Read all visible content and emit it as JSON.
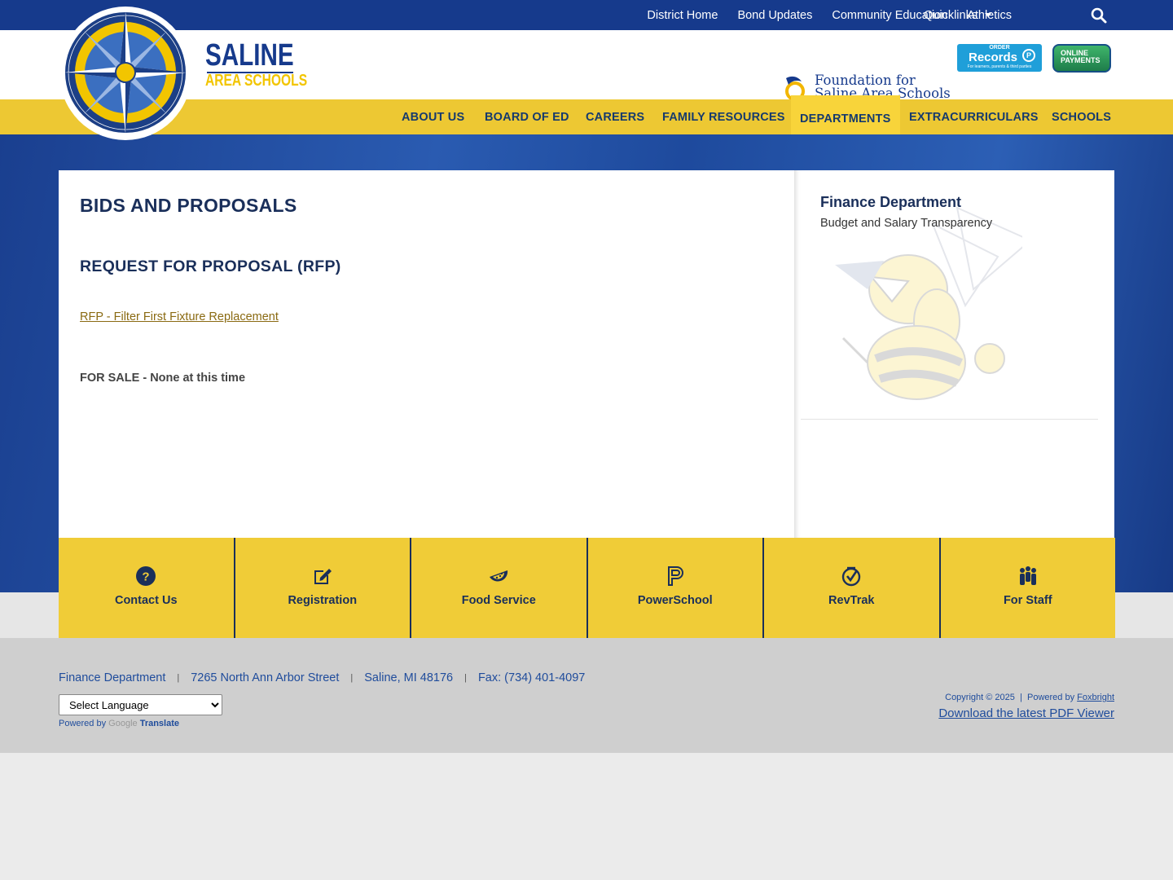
{
  "utility": {
    "links": [
      "District Home",
      "Bond Updates",
      "Community Education",
      "Athletics"
    ],
    "quicklinks": "Quicklinks",
    "search_icon": "search-icon"
  },
  "logo": {
    "line1": "SALINE",
    "line2": "AREA SCHOOLS"
  },
  "partners": {
    "foundation_line1": "Foundation for",
    "foundation_line2": "Saline Area Schools",
    "records_top": "ORDER",
    "records_main": "Records",
    "records_sub": "For learners, parents & third parties",
    "payments_line1": "ONLINE",
    "payments_line2": "PAYMENTS"
  },
  "nav": {
    "items": [
      "ABOUT US",
      "BOARD OF ED",
      "CAREERS",
      "FAMILY RESOURCES",
      "DEPARTMENTS",
      "EXTRACURRICULARS",
      "SCHOOLS"
    ],
    "active": "DEPARTMENTS"
  },
  "content": {
    "page_title": "BIDS AND PROPOSALS",
    "section_title": "REQUEST FOR PROPOSAL (RFP)",
    "rfp_link": "RFP - Filter First Fixture Replacement",
    "for_sale": "FOR SALE - None at this time"
  },
  "sidebar": {
    "title": "Finance Department",
    "link": "Budget and Salary Transparency"
  },
  "tiles": [
    {
      "label": "Contact Us",
      "icon": "question-circle-icon"
    },
    {
      "label": "Registration",
      "icon": "edit-icon"
    },
    {
      "label": "Food Service",
      "icon": "watermelon-icon"
    },
    {
      "label": "PowerSchool",
      "icon": "powerschool-icon"
    },
    {
      "label": "RevTrak",
      "icon": "revtrak-icon"
    },
    {
      "label": "For Staff",
      "icon": "people-icon"
    }
  ],
  "footer": {
    "address": [
      "Finance Department",
      "7265 North Ann Arbor Street",
      "Saline, MI 48176",
      "Fax: (734) 401-4097"
    ],
    "language_select": "Select Language",
    "powered_by": "Powered by",
    "google": "Google",
    "translate": "Translate",
    "copyright": "Copyright © 2025",
    "powered_by_foxbright": "Powered by",
    "foxbright": "Foxbright",
    "pdf_link": "Download the latest PDF Viewer"
  },
  "colors": {
    "navy": "#163a8c",
    "gold": "#edc833",
    "text_dark": "#1a2f5a",
    "link_gold": "#8a6a12",
    "footer_link": "#1f4c9c"
  }
}
